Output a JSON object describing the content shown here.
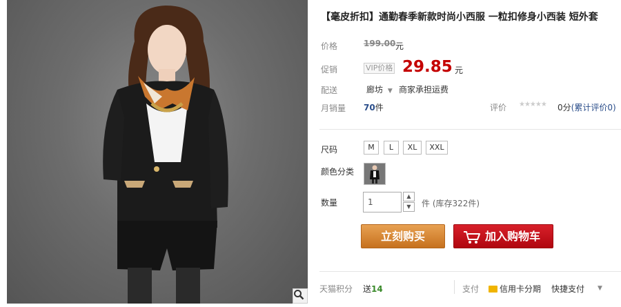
{
  "product": {
    "title": "【毫皮折扣】通勤春季新款时尚小西服 一粒扣修身小西装 短外套"
  },
  "price": {
    "label": "价格",
    "original": "199.00",
    "original_unit": "元"
  },
  "promo": {
    "label": "促销",
    "vip_tag": "VIP价格",
    "price": "29.85",
    "unit": "元"
  },
  "shipping": {
    "label": "配送",
    "city": "廊坊",
    "note": "商家承担运费"
  },
  "sales": {
    "label": "月销量",
    "count": "70",
    "unit": "件"
  },
  "rating": {
    "label": "评价",
    "stars": "★★★★★",
    "score": "0分",
    "count_text": "(累计评价0)"
  },
  "size": {
    "label": "尺码",
    "options": [
      "M",
      "L",
      "XL",
      "XXL"
    ]
  },
  "color": {
    "label": "颜色分类"
  },
  "quantity": {
    "label": "数量",
    "value": "1",
    "unit": "件",
    "stock": "(库存322件)"
  },
  "actions": {
    "buy_now": "立刻购买",
    "add_to_cart": "加入购物车"
  },
  "bottom": {
    "points_label": "天猫积分",
    "points_text": "送",
    "points_value": "14",
    "pay_label": "支付",
    "credit_card": "信用卡分期",
    "quick_pay": "快捷支付"
  },
  "icons": {
    "zoom": "zoom-icon",
    "cart": "cart-icon",
    "dropdown": "chevron-down-icon"
  },
  "colors": {
    "price_red": "#c40000",
    "buy_orange": "#d9893b",
    "cart_red": "#c0111a",
    "link_blue": "#2a4d8a",
    "points_green": "#3a8a2a"
  }
}
